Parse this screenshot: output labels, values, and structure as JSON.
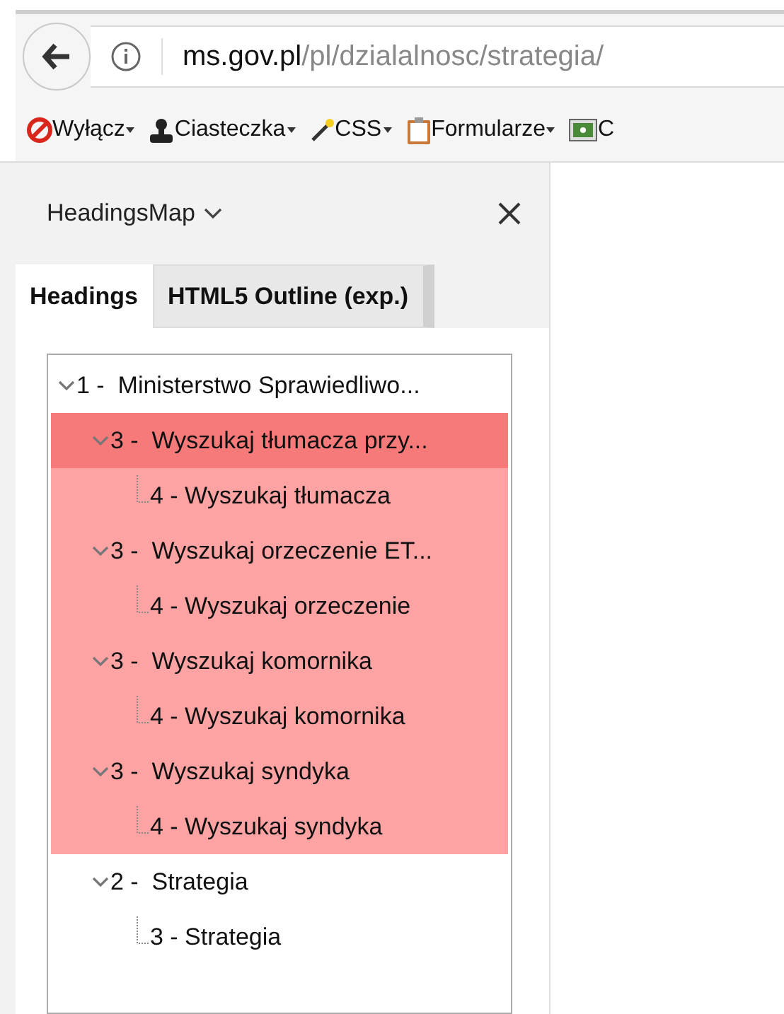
{
  "address_bar": {
    "domain": "ms.gov.pl",
    "path": "/pl/dzialalnosc/strategia/"
  },
  "bookmarks": [
    {
      "kind": "block",
      "label": "Wyłącz",
      "menu": true
    },
    {
      "kind": "person",
      "label": "Ciasteczka",
      "menu": true
    },
    {
      "kind": "wand",
      "label": "CSS",
      "menu": true
    },
    {
      "kind": "clipboard",
      "label": "Formularze",
      "menu": true
    },
    {
      "kind": "image",
      "label": "C",
      "menu": false
    }
  ],
  "sidebar": {
    "title": "HeadingsMap",
    "tabs": [
      {
        "label": "Headings",
        "selected": true
      },
      {
        "label": "HTML5 Outline (exp.)",
        "selected": false
      }
    ],
    "tree": [
      {
        "label": "1 -  Ministerstwo Sprawiedliwo...",
        "selected": false,
        "flagged": false,
        "expanded": true,
        "children": [
          {
            "label": "3 -  Wyszukaj tłumacza przy...",
            "selected": true,
            "flagged": true,
            "expanded": true,
            "children": [
              {
                "label": "4 - Wyszukaj tłumacza",
                "selected": false,
                "flagged": true
              }
            ]
          },
          {
            "label": "3 -  Wyszukaj orzeczenie ET...",
            "selected": false,
            "flagged": true,
            "expanded": true,
            "children": [
              {
                "label": "4 - Wyszukaj orzeczenie",
                "selected": false,
                "flagged": true
              }
            ]
          },
          {
            "label": "3 -  Wyszukaj komornika",
            "selected": false,
            "flagged": true,
            "expanded": true,
            "children": [
              {
                "label": "4 - Wyszukaj komornika",
                "selected": false,
                "flagged": true
              }
            ]
          },
          {
            "label": "3 -  Wyszukaj syndyka",
            "selected": false,
            "flagged": true,
            "expanded": true,
            "children": [
              {
                "label": "4 - Wyszukaj syndyka",
                "selected": false,
                "flagged": true
              }
            ]
          },
          {
            "label": "2 -  Strategia",
            "selected": false,
            "flagged": false,
            "expanded": true,
            "children": [
              {
                "label": "3 - Strategia",
                "selected": false,
                "flagged": false
              }
            ]
          }
        ]
      }
    ]
  }
}
